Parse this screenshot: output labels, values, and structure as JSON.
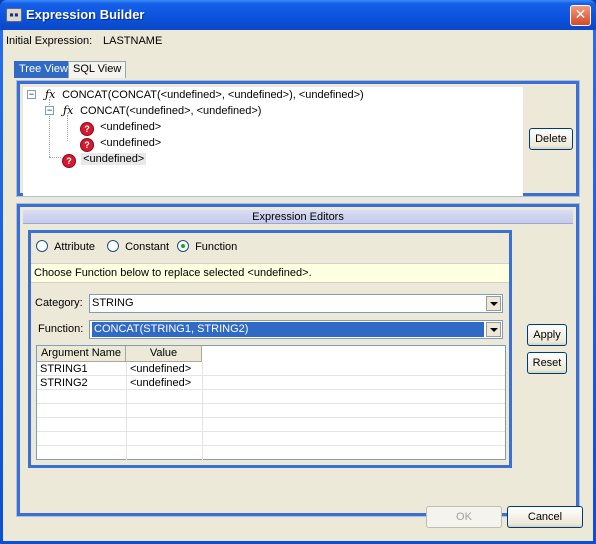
{
  "window": {
    "title": "Expression Builder",
    "close_glyph": "✕"
  },
  "initial_expression": {
    "label": "Initial Expression:",
    "value": "LASTNAME"
  },
  "tabs": [
    {
      "label": "Tree View",
      "active": true
    },
    {
      "label": "SQL View",
      "active": false
    }
  ],
  "tree": {
    "nodes": [
      {
        "label": "CONCAT(CONCAT(<undefined>, <undefined>), <undefined>)",
        "icon": "function-icon"
      },
      {
        "label": "CONCAT(<undefined>, <undefined>)",
        "icon": "function-icon"
      },
      {
        "label": "<undefined>",
        "icon": "undefined-icon"
      },
      {
        "label": "<undefined>",
        "icon": "undefined-icon"
      },
      {
        "label": "<undefined>",
        "icon": "undefined-icon",
        "selected": true
      }
    ],
    "toggle_glyph": "−"
  },
  "delete_button": "Delete",
  "editors": {
    "header": "Expression Editors",
    "radios": [
      {
        "label": "Attribute",
        "checked": false
      },
      {
        "label": "Constant",
        "checked": false
      },
      {
        "label": "Function",
        "checked": true
      }
    ],
    "hint": "Choose Function below to replace selected <undefined>.",
    "category_label": "Category:",
    "category_value": "STRING",
    "function_label": "Function:",
    "function_value": "CONCAT(STRING1, STRING2)",
    "table": {
      "headers": [
        "Argument Name",
        "Value"
      ],
      "rows": [
        [
          "STRING1",
          "<undefined>"
        ],
        [
          "STRING2",
          "<undefined>"
        ]
      ]
    }
  },
  "apply_button": "Apply",
  "reset_button": "Reset",
  "ok_button": "OK",
  "cancel_button": "Cancel"
}
